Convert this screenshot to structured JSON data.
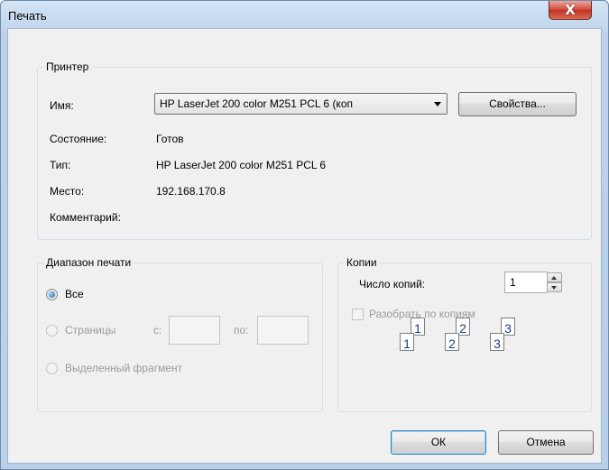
{
  "window": {
    "title": "Печать",
    "close_label": "X"
  },
  "printer": {
    "group_label": "Принтер",
    "name_label": "Имя:",
    "name_value": "HP LaserJet 200 color M251 PCL 6 (коп",
    "properties_button": "Свойства...",
    "status_label": "Состояние:",
    "status_value": "Готов",
    "type_label": "Тип:",
    "type_value": "HP LaserJet 200 color M251 PCL 6",
    "location_label": "Место:",
    "location_value": "192.168.170.8",
    "comment_label": "Комментарий:",
    "comment_value": ""
  },
  "range": {
    "group_label": "Диапазон печати",
    "all_label": "Все",
    "pages_label": "Страницы",
    "from_label": "с:",
    "to_label": "по:",
    "from_value": "",
    "to_value": "",
    "selection_label": "Выделенный фрагмент",
    "selected": "all"
  },
  "copies": {
    "group_label": "Копии",
    "count_label": "Число копий:",
    "count_value": "1",
    "collate_label": "Разобрать по копиям",
    "collate_checked": false,
    "collate_pages": [
      "1",
      "1",
      "2",
      "2",
      "3",
      "3"
    ]
  },
  "footer": {
    "ok_button": "ОК",
    "cancel_button": "Отмена"
  }
}
